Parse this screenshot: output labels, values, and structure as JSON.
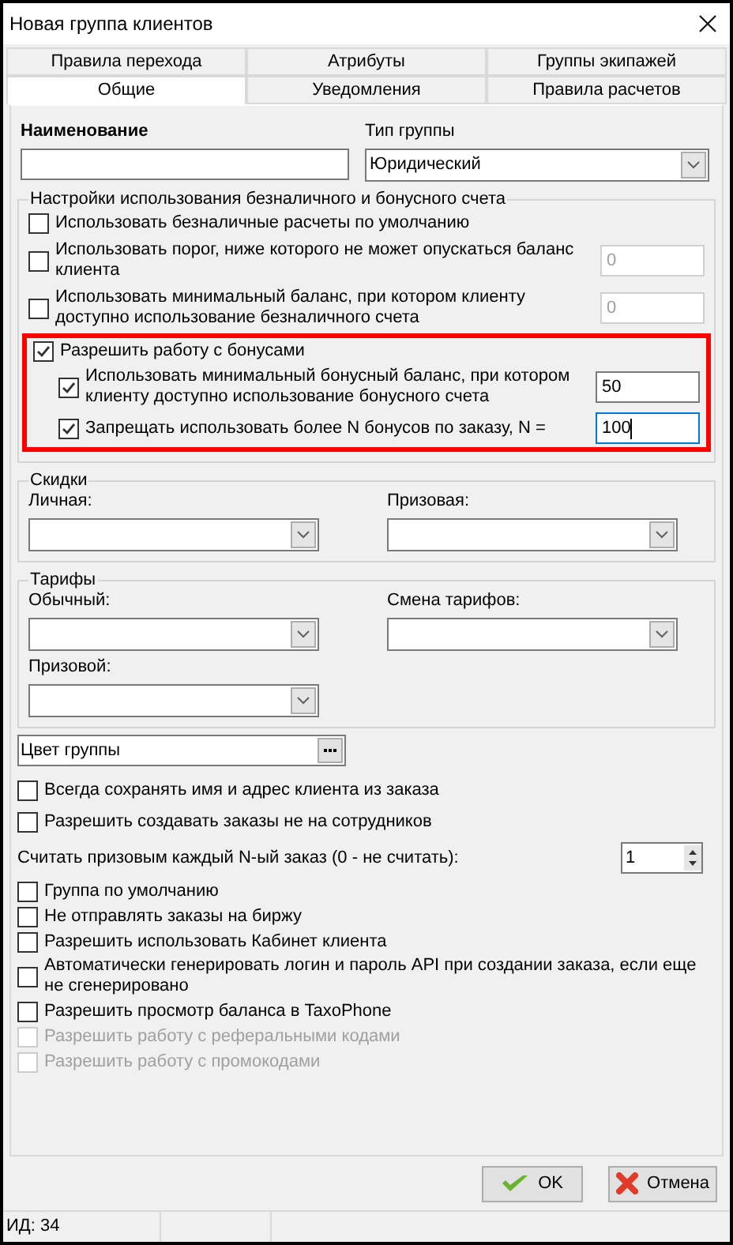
{
  "window": {
    "title": "Новая группа клиентов"
  },
  "tabs": [
    [
      {
        "label": "Правила перехода",
        "selected": false
      },
      {
        "label": "Атрибуты",
        "selected": false
      },
      {
        "label": "Группы экипажей",
        "selected": false
      }
    ],
    [
      {
        "label": "Общие",
        "selected": true
      },
      {
        "label": "Уведомления",
        "selected": false
      },
      {
        "label": "Правила расчетов",
        "selected": false
      }
    ]
  ],
  "name_field": {
    "label": "Наименование"
  },
  "group_type": {
    "label": "Тип группы",
    "value": "Юридический"
  },
  "account_settings": {
    "title": "Настройки использования безналичного и бонусного счета",
    "options": [
      {
        "label": "Использовать безналичные расчеты по умолчанию",
        "checked": false
      },
      {
        "label": "Использовать порог, ниже которого не может опускаться баланс клиента",
        "checked": false,
        "value": "0",
        "field_disabled": true
      },
      {
        "label": "Использовать минимальный баланс, при котором клиенту доступно использование безналичного счета",
        "checked": false,
        "value": "0",
        "field_disabled": true
      }
    ],
    "bonus": {
      "highlighted": true,
      "label": "Разрешить работу с бонусами",
      "checked": true,
      "sub_options": [
        {
          "label": "Использовать минимальный бонусный баланс, при котором клиенту доступно использование бонусного счета",
          "checked": true,
          "value": "50",
          "focused": false
        },
        {
          "label": "Запрещать использовать более N бонусов по заказу, N =",
          "checked": true,
          "value": "100",
          "focused": true
        }
      ]
    }
  },
  "discounts": {
    "title": "Скидки",
    "fields": [
      {
        "label": "Личная:"
      },
      {
        "label": "Призовая:"
      }
    ]
  },
  "tariffs": {
    "title": "Тарифы",
    "fields": [
      {
        "label": "Обычный:"
      },
      {
        "label": "Смена тарифов:"
      },
      {
        "label": "Призовой:"
      }
    ]
  },
  "color_field": {
    "value": "Цвет группы"
  },
  "options": [
    {
      "kind": "checkbox",
      "label": "Всегда сохранять имя и адрес клиента из заказа",
      "checked": false,
      "disabled": false
    },
    {
      "kind": "checkbox",
      "label": "Разрешить создавать заказы не на сотрудников",
      "checked": false,
      "disabled": false
    },
    {
      "kind": "spinner",
      "label": "Считать призовым каждый N-ый заказ (0 - не считать):",
      "value": "1"
    },
    {
      "kind": "checkbox",
      "label": "Группа по умолчанию",
      "checked": false,
      "disabled": false
    },
    {
      "kind": "checkbox",
      "label": "Не отправлять заказы на биржу",
      "checked": false,
      "disabled": false
    },
    {
      "kind": "checkbox",
      "label": "Разрешить использовать Кабинет клиента",
      "checked": false,
      "disabled": false
    },
    {
      "kind": "checkbox",
      "label": "Автоматически генерировать логин и пароль API при создании заказа, если еще не сгенерировано",
      "checked": false,
      "disabled": false
    },
    {
      "kind": "checkbox",
      "label": "Разрешить просмотр баланса в TaxoPhone",
      "checked": false,
      "disabled": false
    },
    {
      "kind": "checkbox",
      "label": "Разрешить работу с реферальными кодами",
      "checked": false,
      "disabled": true
    },
    {
      "kind": "checkbox",
      "label": "Разрешить работу с промокодами",
      "checked": false,
      "disabled": true
    }
  ],
  "buttons": [
    {
      "kind": "ok",
      "label": "OK"
    },
    {
      "kind": "cancel",
      "label": "Отмена"
    }
  ],
  "status_bar": [
    "ИД: 34"
  ]
}
